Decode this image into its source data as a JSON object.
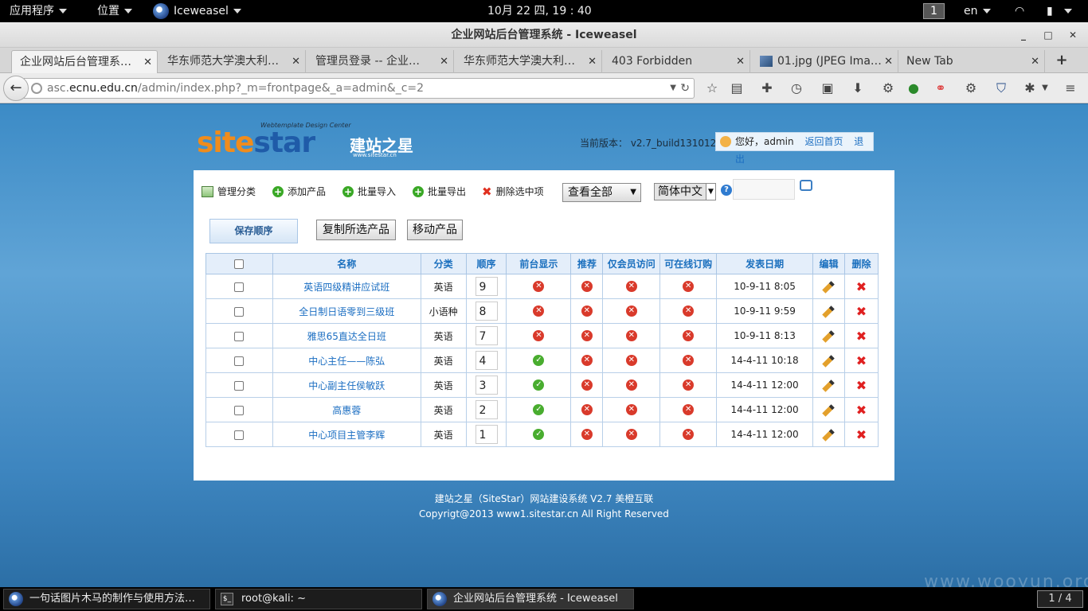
{
  "topbar": {
    "apps_label": "应用程序",
    "places_label": "位置",
    "app_name": "Iceweasel",
    "clock": "10月 22 四, 19 : 40",
    "workspace": "1",
    "lang": "en"
  },
  "window": {
    "title": "企业网站后台管理系统 - Iceweasel",
    "min": "_",
    "max": "□",
    "close": "✕"
  },
  "tabs": [
    {
      "label": "企业网站后台管理系…",
      "active": true
    },
    {
      "label": "华东师范大学澳大利…"
    },
    {
      "label": "管理员登录 -- 企业…"
    },
    {
      "label": "华东师范大学澳大利…"
    },
    {
      "label": "403 Forbidden"
    },
    {
      "label": "01.jpg (JPEG Ima…"
    },
    {
      "label": "New Tab"
    }
  ],
  "tab_close": "✕",
  "newtab": "+",
  "url": {
    "prefix": "asc.",
    "host": "ecnu.edu.cn",
    "path": "/admin/index.php?_m=frontpage&_a=admin&_c=2"
  },
  "site": {
    "logo_en_1": "site",
    "logo_en_2": "star",
    "logo_cn": "建站之星",
    "logo_tag": "Webtemplate Design Center",
    "logo_url": "www.sitestar.cn",
    "version": "当前版本： v2.7_build131012",
    "greeting": "您好，admin",
    "home_link": "返回首页",
    "logout_link": "退出"
  },
  "toolbar": {
    "manage_category": "管理分类",
    "add_product": "添加产品",
    "batch_import": "批量导入",
    "batch_export": "批量导出",
    "delete_selected": "删除选中项",
    "view_all": "查看全部",
    "language": "简体中文",
    "save_order": "保存顺序",
    "copy_selected": "复制所选产品",
    "move_product": "移动产品"
  },
  "table": {
    "headers": [
      "名称",
      "分类",
      "顺序",
      "前台显示",
      "推荐",
      "仅会员访问",
      "可在线订购",
      "发表日期",
      "编辑",
      "删除"
    ],
    "rows": [
      {
        "name": "英语四级精讲应试班",
        "category": "英语",
        "order": "9",
        "shown": false,
        "date": "10-9-11 8:05"
      },
      {
        "name": "全日制日语零到三级班",
        "category": "小语种",
        "order": "8",
        "shown": false,
        "date": "10-9-11 9:59"
      },
      {
        "name": "雅思65直达全日班",
        "category": "英语",
        "order": "7",
        "shown": false,
        "date": "10-9-11 8:13"
      },
      {
        "name": "中心主任——陈弘",
        "category": "英语",
        "order": "4",
        "shown": true,
        "date": "14-4-11 10:18"
      },
      {
        "name": "中心副主任侯敏跃",
        "category": "英语",
        "order": "3",
        "shown": true,
        "date": "14-4-11 12:00"
      },
      {
        "name": "高惠蓉",
        "category": "英语",
        "order": "2",
        "shown": true,
        "date": "14-4-11 12:00"
      },
      {
        "name": "中心项目主管李辉",
        "category": "英语",
        "order": "1",
        "shown": true,
        "date": "14-4-11 12:00"
      }
    ]
  },
  "footer": {
    "line1": "建站之星（SiteStar）网站建设系统 V2.7 美橙互联",
    "line2": "Copyrigt@2013 www1.sitestar.cn All Right Reserved"
  },
  "watermark": "www.wooyun.org",
  "taskbar": {
    "task1": "一句话图片木马的制作与使用方法…",
    "task2": "root@kali: ~",
    "task3": "企业网站后台管理系统 - Iceweasel",
    "pager": "1 / 4"
  },
  "colors": {
    "link": "#1b6ec2",
    "header_bg": "#e4eefa",
    "no": "#d93a2b",
    "yes": "#49ad2f"
  }
}
